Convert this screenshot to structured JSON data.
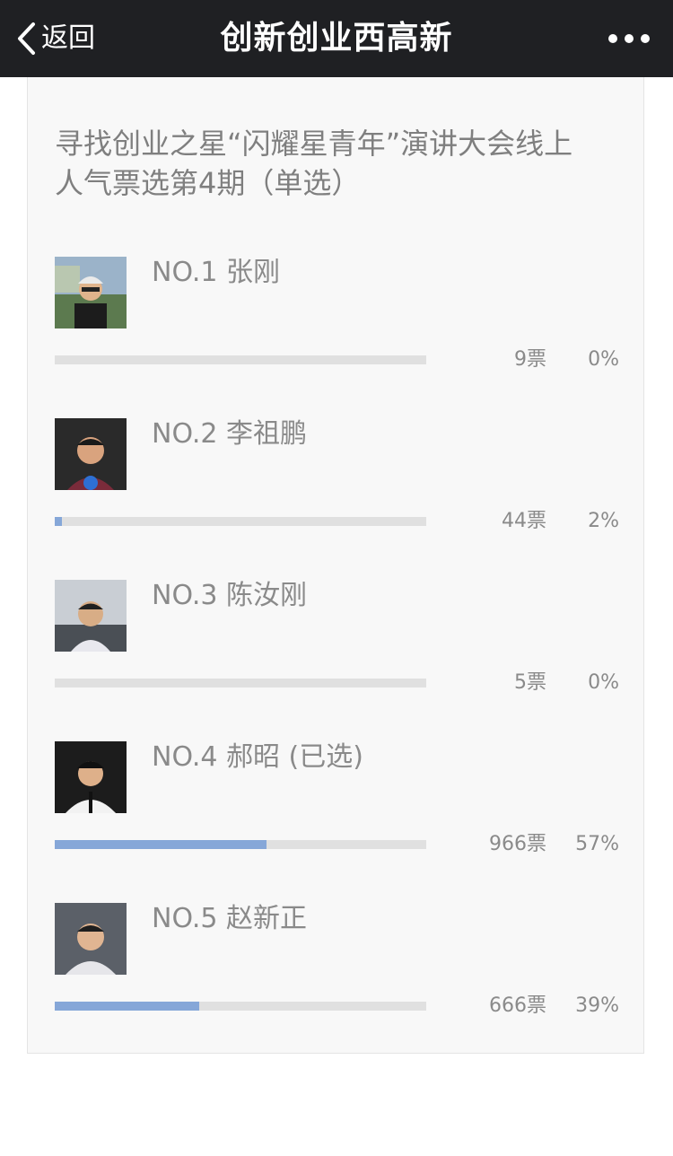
{
  "nav": {
    "back_label": "返回",
    "title": "创新创业西高新",
    "more_icon": "more-dots-icon",
    "back_icon": "chevron-left-icon",
    "background": "#1f2023"
  },
  "poll": {
    "title_line1": "寻找创业之星“闪耀星青年”演讲大会线上",
    "title_line2": "人气票选第4期（单选）",
    "accent_color": "#86a7d8",
    "options": [
      {
        "label": "NO.1 张刚",
        "votes": "9票",
        "percent": "0%",
        "fill": 0.0
      },
      {
        "label": "NO.2 李祖鹏",
        "votes": "44票",
        "percent": "2%",
        "fill": 0.02
      },
      {
        "label": "NO.3 陈汝刚",
        "votes": "5票",
        "percent": "0%",
        "fill": 0.0
      },
      {
        "label": "NO.4 郝昭 (已选)",
        "votes": "966票",
        "percent": "57%",
        "fill": 0.57
      },
      {
        "label": "NO.5 赵新正",
        "votes": "666票",
        "percent": "39%",
        "fill": 0.39
      }
    ]
  }
}
